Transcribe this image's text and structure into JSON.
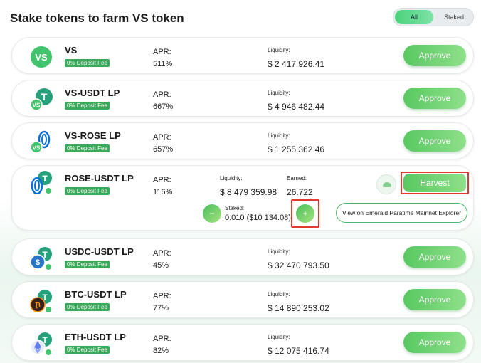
{
  "header": {
    "title": "Stake tokens to farm VS token",
    "filter_all": "All",
    "filter_staked": "Staked"
  },
  "labels": {
    "apr": "APR:",
    "liquidity": "Liquidity:",
    "earned": "Earned:",
    "staked": "Staked:",
    "fee": "0% Deposit Fee",
    "approve": "Approve",
    "harvest": "Harvest",
    "minus": "−",
    "plus": "+",
    "explorer": "View on Emerald Paratime Mainnet Explorer"
  },
  "pools": [
    {
      "name": "VS",
      "apr": "511%",
      "liquidity": "$ 2 417 926.41",
      "icon": "vs-token-icon"
    },
    {
      "name": "VS-USDT LP",
      "apr": "667%",
      "liquidity": "$ 4 946 482.44",
      "icon": "vs-usdt-lp-icon"
    },
    {
      "name": "VS-ROSE LP",
      "apr": "657%",
      "liquidity": "$ 1 255 362.46",
      "icon": "vs-rose-lp-icon"
    },
    {
      "name": "ROSE-USDT LP",
      "apr": "116%",
      "liquidity": "$ 8 479 359.98",
      "earned": "26.722",
      "staked": "0.010 ($10 134.08)",
      "icon": "rose-usdt-lp-icon"
    },
    {
      "name": "USDC-USDT LP",
      "apr": "45%",
      "liquidity": "$ 32 470 793.50",
      "icon": "usdc-usdt-lp-icon"
    },
    {
      "name": "BTC-USDT LP",
      "apr": "77%",
      "liquidity": "$ 14 890 253.02",
      "icon": "btc-usdt-lp-icon"
    },
    {
      "name": "ETH-USDT LP",
      "apr": "82%",
      "liquidity": "$ 12 075 416.74",
      "icon": "eth-usdt-lp-icon"
    }
  ],
  "colors": {
    "accent_green": "#58c861",
    "fee_badge": "#3aa95a",
    "highlight": "#e0392e",
    "tether": "#26a17b",
    "rose": "#0a6fd6",
    "usdc": "#2775ca",
    "btc": "#f7931a",
    "eth": "#627eea"
  }
}
